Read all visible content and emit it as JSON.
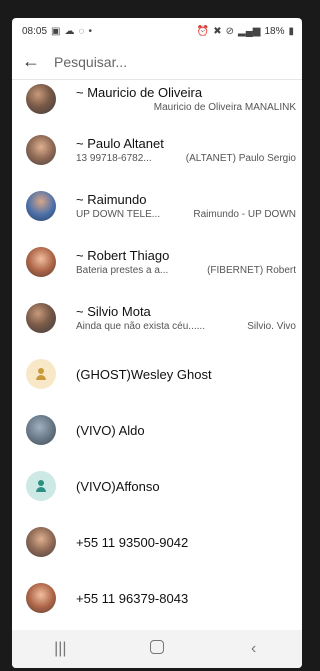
{
  "status": {
    "time": "08:05",
    "battery": "18%"
  },
  "search": {
    "placeholder": "Pesquisar..."
  },
  "contacts": [
    {
      "name": "~ Mauricio de Oliveira",
      "left": "",
      "right": "Mauricio de Oliveira MANALINK"
    },
    {
      "name": "~ Paulo Altanet",
      "left": "13 99718-6782...",
      "right": "(ALTANET) Paulo Sergio"
    },
    {
      "name": "~ Raimundo",
      "left": "UP DOWN TELE...",
      "right": "Raimundo - UP DOWN"
    },
    {
      "name": "~ Robert Thiago",
      "left": "Bateria prestes a a...",
      "right": "(FIBERNET) Robert"
    },
    {
      "name": "~ Silvio Mota",
      "left": "Ainda que não exista céu......",
      "right": "Silvio. Vivo"
    },
    {
      "name": "(GHOST)Wesley Ghost"
    },
    {
      "name": "(VIVO) Aldo"
    },
    {
      "name": "(VIVO)Affonso"
    },
    {
      "name": "+55 11 93500-9042"
    },
    {
      "name": "+55 11 96379-8043"
    }
  ],
  "icons": {
    "back": "arrow-left",
    "nav_recent": "recent-apps",
    "nav_home": "home",
    "nav_back": "back"
  }
}
